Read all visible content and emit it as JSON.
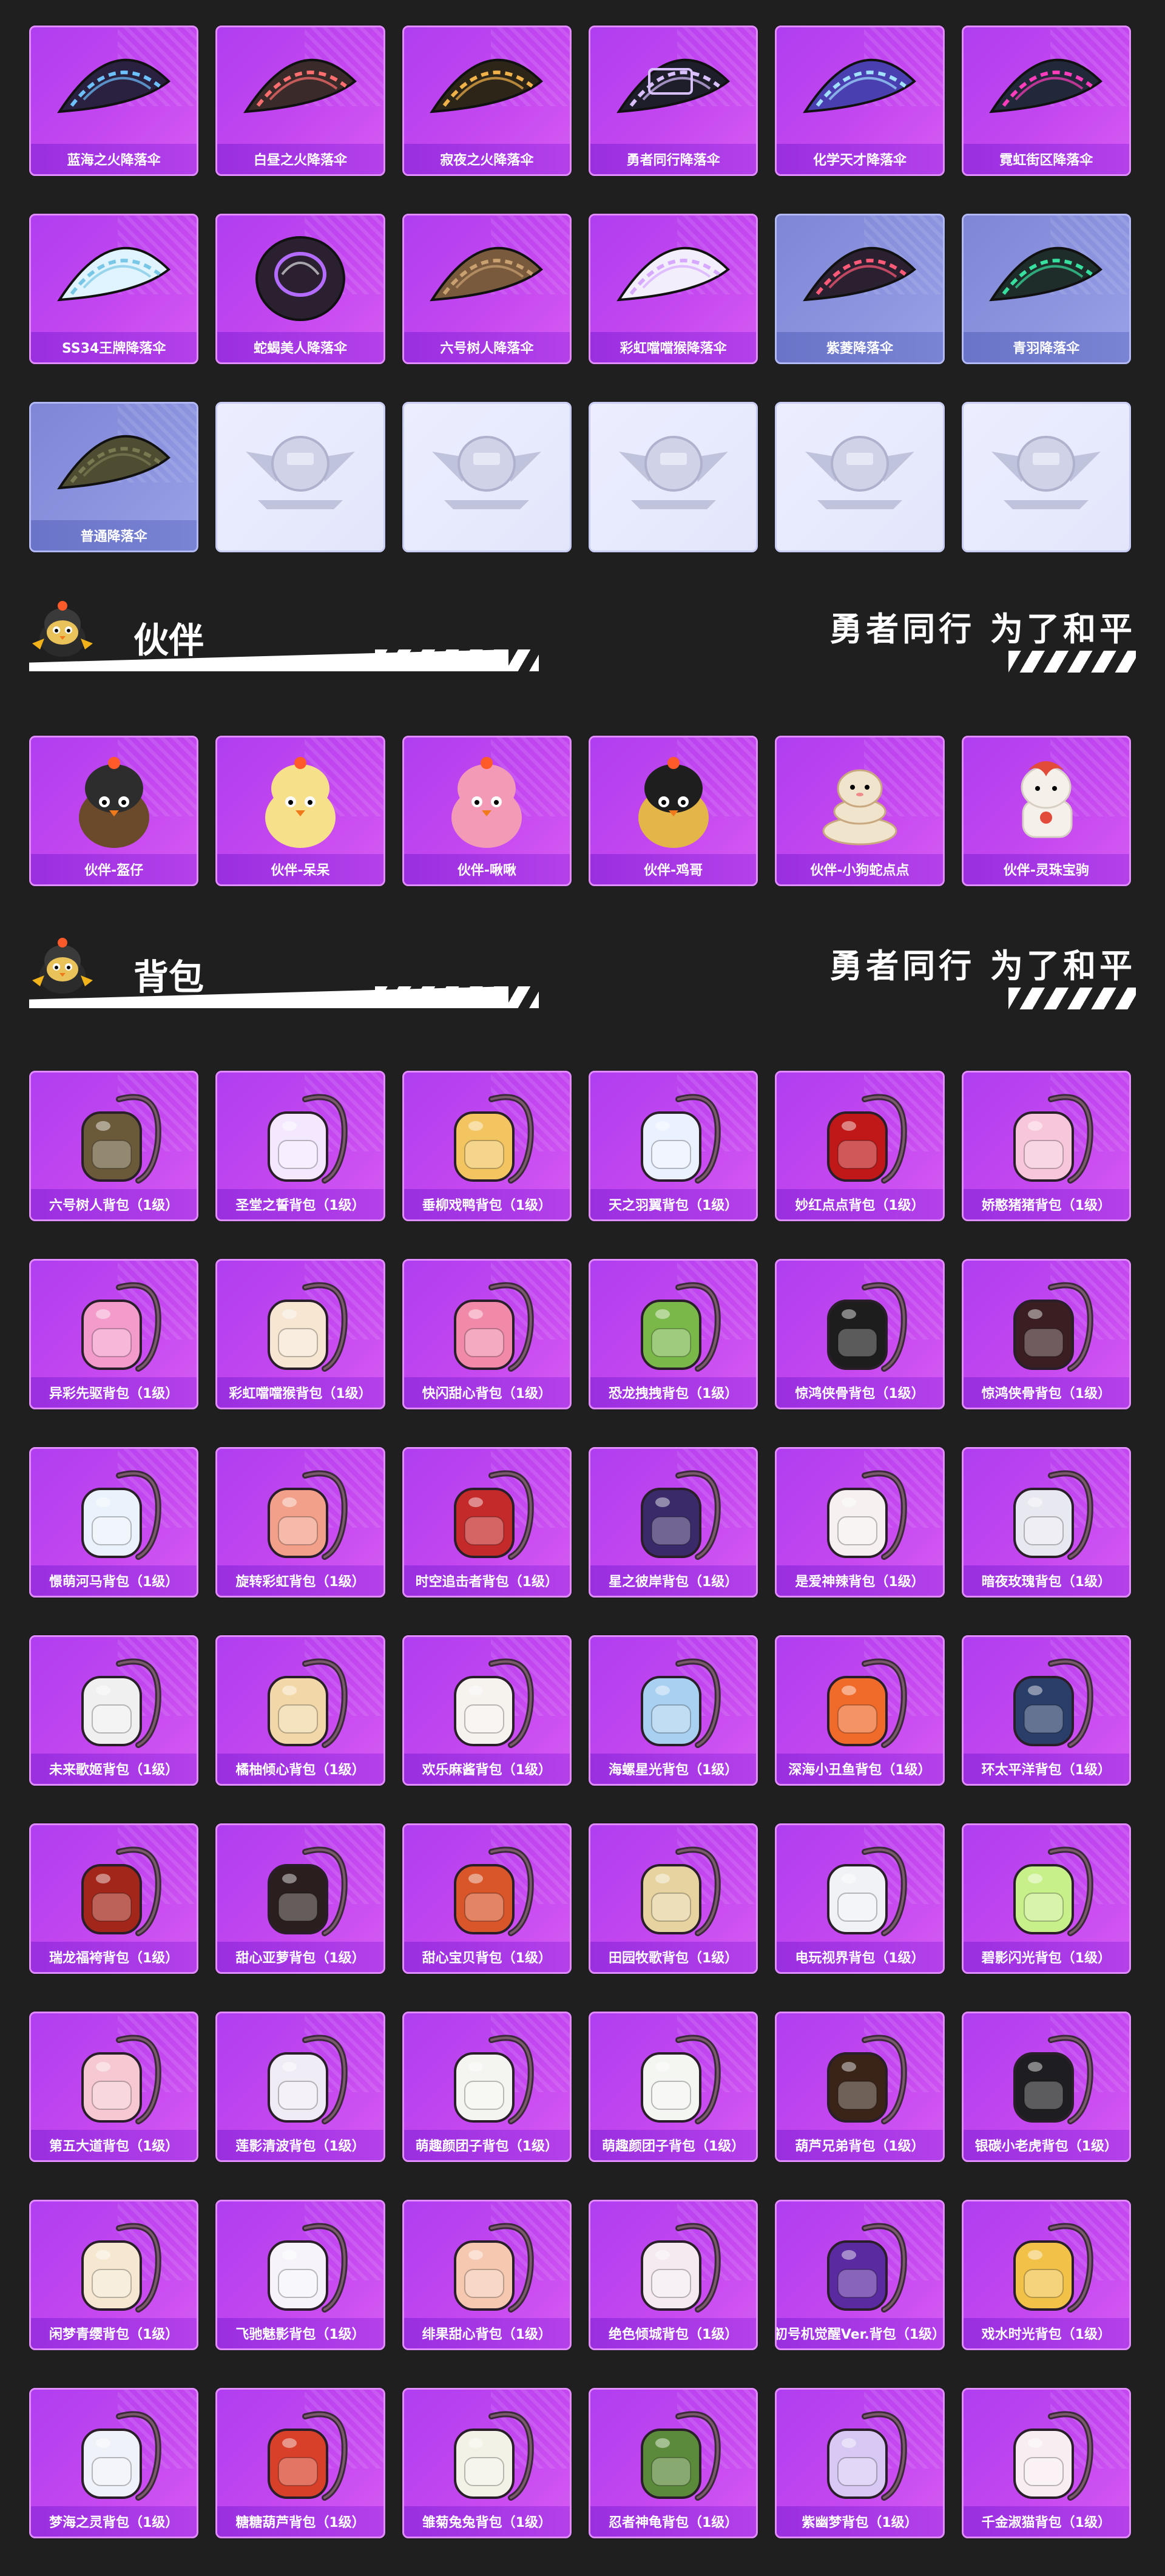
{
  "parachutes": {
    "items": [
      {
        "label": "蓝海之火降落伞",
        "style": "purple",
        "art": "parachute",
        "color": "#2a2040",
        "accent": "#6ec1ff"
      },
      {
        "label": "白昼之火降落伞",
        "style": "purple",
        "art": "parachute",
        "color": "#3a2a2a",
        "accent": "#ff6f6f"
      },
      {
        "label": "寂夜之火降落伞",
        "style": "purple",
        "art": "parachute",
        "color": "#2d2518",
        "accent": "#f2b24a"
      },
      {
        "label": "勇者同行降落伞",
        "style": "purple",
        "art": "parachute-badge",
        "color": "#1e1e2a",
        "accent": "#d9c1ff"
      },
      {
        "label": "化学天才降落伞",
        "style": "purple",
        "art": "parachute",
        "color": "#4a3fb0",
        "accent": "#a1e0ff"
      },
      {
        "label": "霓虹街区降落伞",
        "style": "purple",
        "art": "parachute",
        "color": "#20283a",
        "accent": "#ff3dbc"
      },
      {
        "label": "SS34王牌降落伞",
        "style": "purple",
        "art": "parachute",
        "color": "#dff4ff",
        "accent": "#79c7e6"
      },
      {
        "label": "蛇蝎美人降落伞",
        "style": "purple",
        "art": "parachute-round",
        "color": "#2a2030",
        "accent": "#b46bff"
      },
      {
        "label": "六号树人降落伞",
        "style": "purple",
        "art": "parachute",
        "color": "#7a5a3c",
        "accent": "#c9a070"
      },
      {
        "label": "彩虹噹噹猴降落伞",
        "style": "purple",
        "art": "parachute",
        "color": "#f3eefc",
        "accent": "#d6a8ff"
      },
      {
        "label": "紫菱降落伞",
        "style": "blue",
        "art": "parachute",
        "color": "#2a2030",
        "accent": "#ff5a78"
      },
      {
        "label": "青羽降落伞",
        "style": "blue",
        "art": "parachute",
        "color": "#1e2c2a",
        "accent": "#38e0a0"
      },
      {
        "label": "普通降落伞",
        "style": "blue",
        "art": "parachute",
        "color": "#4e4d32",
        "accent": "#7a7a52"
      },
      {
        "label": "",
        "style": "empty",
        "art": "emblem",
        "color": "#d0d3e8",
        "accent": "#bfc3dc"
      },
      {
        "label": "",
        "style": "empty",
        "art": "emblem",
        "color": "#d0d3e8",
        "accent": "#bfc3dc"
      },
      {
        "label": "",
        "style": "empty",
        "art": "emblem",
        "color": "#d0d3e8",
        "accent": "#bfc3dc"
      },
      {
        "label": "",
        "style": "empty",
        "art": "emblem",
        "color": "#d0d3e8",
        "accent": "#bfc3dc"
      },
      {
        "label": "",
        "style": "empty",
        "art": "emblem",
        "color": "#d0d3e8",
        "accent": "#bfc3dc"
      }
    ]
  },
  "partner_section": {
    "title": "伙伴",
    "slogan": "勇者同行 为了和平",
    "mascot_icon": "chick-helmet-icon",
    "items": [
      {
        "label": "伙伴-盔仔",
        "art": "chick",
        "color": "#6a4a2a",
        "accent": "#2d2d2d"
      },
      {
        "label": "伙伴-呆呆",
        "art": "chick",
        "color": "#f7e08a",
        "accent": "#f7e08a"
      },
      {
        "label": "伙伴-啾啾",
        "art": "chick",
        "color": "#f29ab6",
        "accent": "#f29ab6"
      },
      {
        "label": "伙伴-鸡哥",
        "art": "chick",
        "color": "#e4b64a",
        "accent": "#1e1e1e"
      },
      {
        "label": "伙伴-小狗蛇点点",
        "art": "snake",
        "color": "#f1e4cc",
        "accent": "#f1e4cc"
      },
      {
        "label": "伙伴-灵珠宝驹",
        "art": "pony",
        "color": "#f5f0ea",
        "accent": "#e24a3a"
      }
    ]
  },
  "backpack_section": {
    "title": "背包",
    "slogan": "勇者同行 为了和平",
    "mascot_icon": "chick-helmet-icon",
    "items": [
      {
        "label": "六号树人背包（1级）",
        "color": "#6a5a3a"
      },
      {
        "label": "圣堂之誓背包（1级）",
        "color": "#f4e8ff"
      },
      {
        "label": "垂柳戏鸭背包（1级）",
        "color": "#f2c560"
      },
      {
        "label": "天之羽翼背包（1级）",
        "color": "#eaf1ff"
      },
      {
        "label": "妙红点点背包（1级）",
        "color": "#c01818"
      },
      {
        "label": "娇憨猪猪背包（1级）",
        "color": "#f7c6da"
      },
      {
        "label": "异彩先驱背包（1级）",
        "color": "#f39bcb"
      },
      {
        "label": "彩虹噹噹猴背包（1级）",
        "color": "#f6e6d2"
      },
      {
        "label": "快闪甜心背包（1级）",
        "color": "#f08aa8"
      },
      {
        "label": "恐龙拽拽背包（1级）",
        "color": "#7ab84a"
      },
      {
        "label": "惊鸿侠骨背包（1级）",
        "color": "#1d1d1d"
      },
      {
        "label": "惊鸿侠骨背包（1级）",
        "color": "#3a1e22"
      },
      {
        "label": "憬萌河马背包（1级）",
        "color": "#eaf3fb"
      },
      {
        "label": "旋转彩虹背包（1级）",
        "color": "#f2a08a"
      },
      {
        "label": "时空追击者背包（1级）",
        "color": "#c52a2a"
      },
      {
        "label": "星之彼岸背包（1级）",
        "color": "#3a2a6a"
      },
      {
        "label": "是爱神辣背包（1级）",
        "color": "#f6f0f0"
      },
      {
        "label": "暗夜玫瑰背包（1级）",
        "color": "#e8e8f0"
      },
      {
        "label": "未来歌姬背包（1级）",
        "color": "#f0f0f0"
      },
      {
        "label": "橘柚倾心背包（1级）",
        "color": "#f2d8a8"
      },
      {
        "label": "欢乐麻酱背包（1级）",
        "color": "#f6f2ee"
      },
      {
        "label": "海螺星光背包（1级）",
        "color": "#a8d0f0"
      },
      {
        "label": "深海小丑鱼背包（1级）",
        "color": "#f06a2a"
      },
      {
        "label": "环太平洋背包（1级）",
        "color": "#2a3e6a"
      },
      {
        "label": "瑞龙福袴背包（1级）",
        "color": "#a2261a"
      },
      {
        "label": "甜心亚萝背包（1级）",
        "color": "#2a1e1e"
      },
      {
        "label": "甜心宝贝背包（1级）",
        "color": "#d8562a"
      },
      {
        "label": "田园牧歌背包（1级）",
        "color": "#e6d3a0"
      },
      {
        "label": "电玩视界背包（1级）",
        "color": "#f0f2f6"
      },
      {
        "label": "碧影闪光背包（1级）",
        "color": "#c8f08a"
      },
      {
        "label": "第五大道背包（1级）",
        "color": "#f6c8d2"
      },
      {
        "label": "莲影清波背包（1级）",
        "color": "#f0ecf6"
      },
      {
        "label": "萌趣颜团子背包（1级）",
        "color": "#f4f4f0"
      },
      {
        "label": "萌趣颜团子背包（1级）",
        "color": "#f4f6f2"
      },
      {
        "label": "葫芦兄弟背包（1级）",
        "color": "#3a2418"
      },
      {
        "label": "银碳小老虎背包（1级）",
        "color": "#1e1e22"
      },
      {
        "label": "闲梦青缨背包（1级）",
        "color": "#f6e8d0"
      },
      {
        "label": "飞驰魅影背包（1级）",
        "color": "#f6f4fa"
      },
      {
        "label": "绯果甜心背包（1级）",
        "color": "#f6c8b0"
      },
      {
        "label": "绝色倾城背包（1级）",
        "color": "#f4eaf0"
      },
      {
        "label": "初号机觉醒Ver.背包（1级）",
        "color": "#5a2aa0"
      },
      {
        "label": "戏水时光背包（1级）",
        "color": "#f2c248"
      },
      {
        "label": "梦海之灵背包（1级）",
        "color": "#f0f2fa"
      },
      {
        "label": "糖糖葫芦背包（1级）",
        "color": "#d8402a"
      },
      {
        "label": "雏菊兔兔背包（1级）",
        "color": "#f2f2e6"
      },
      {
        "label": "忍者神龟背包（1级）",
        "color": "#5a8a3a"
      },
      {
        "label": "紫幽梦背包（1级）",
        "color": "#d8c8f4"
      },
      {
        "label": "千金淑猫背包（1级）",
        "color": "#f8eef2"
      }
    ]
  }
}
